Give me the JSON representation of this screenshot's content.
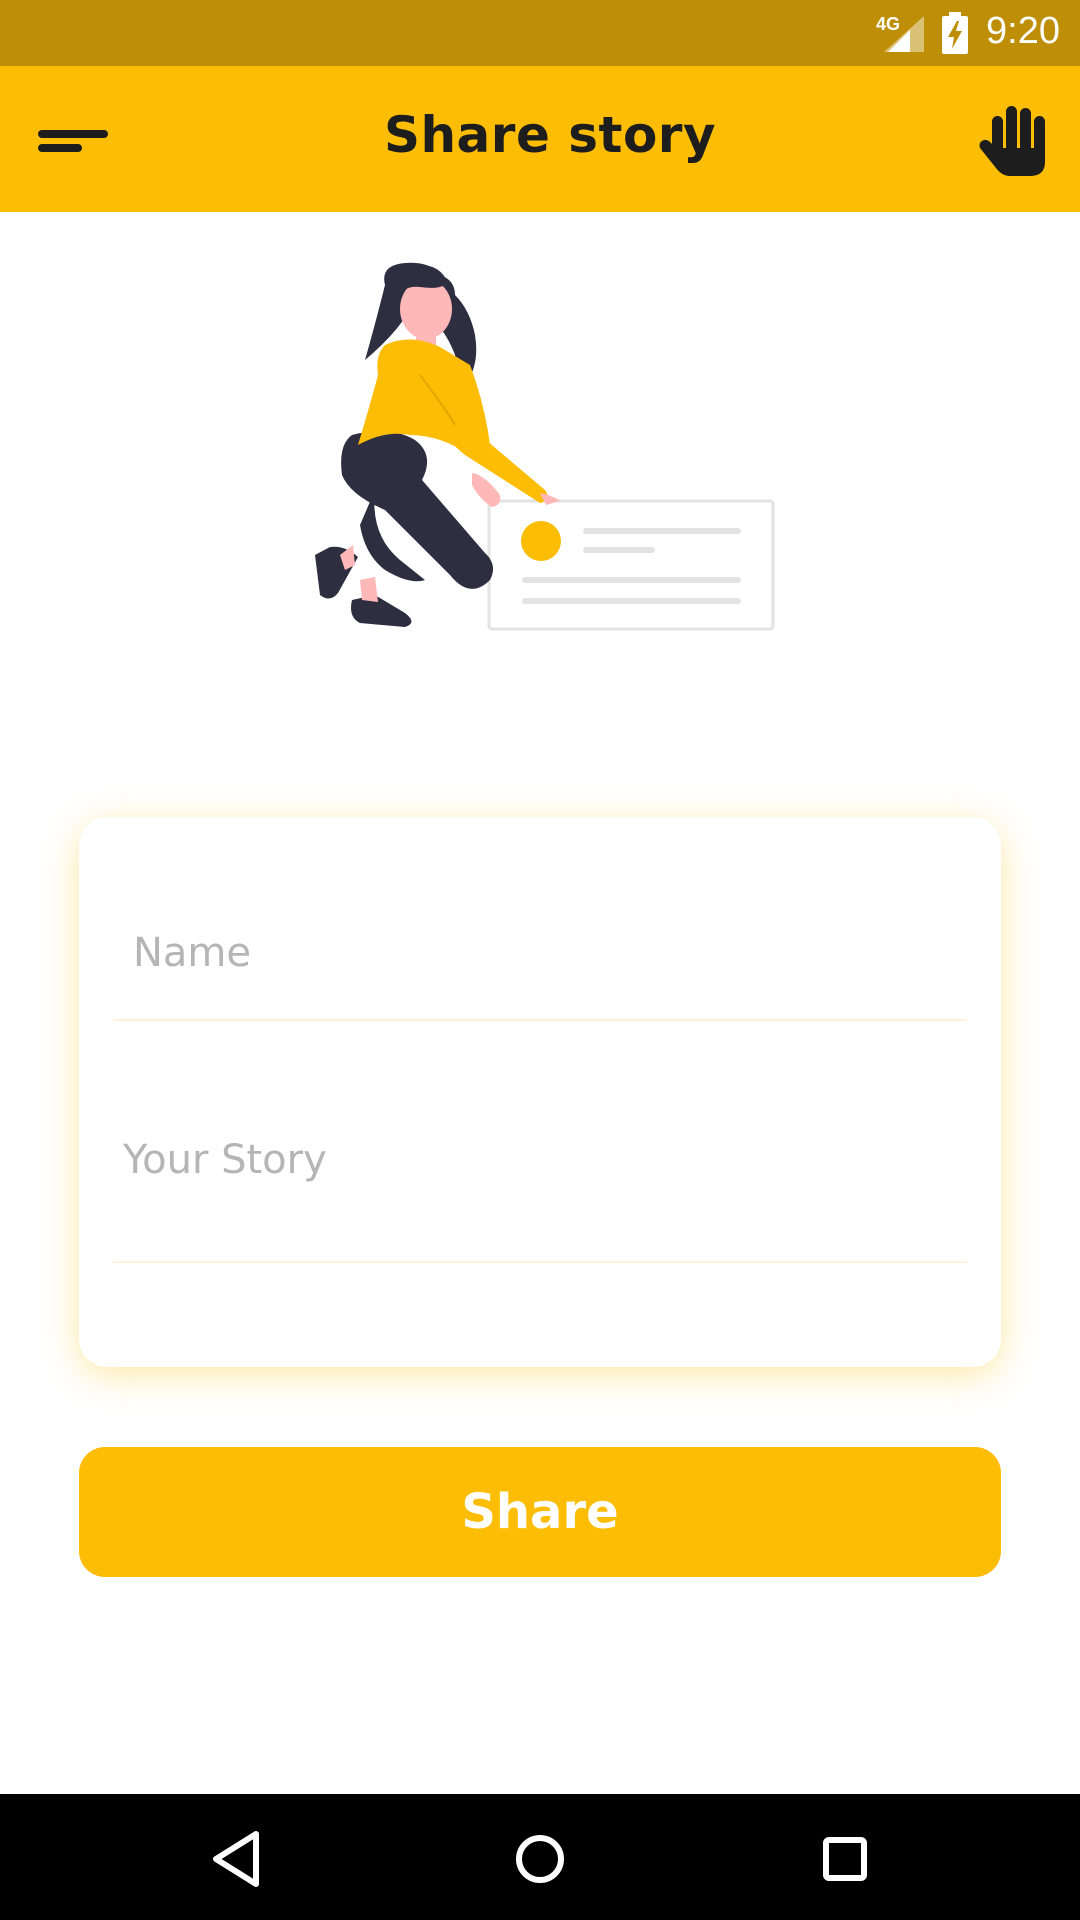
{
  "status_bar": {
    "network": "4G",
    "time": "9:20"
  },
  "app_bar": {
    "title": "Share story",
    "menu_icon": "menu-icon",
    "action_icon": "hand-icon"
  },
  "form": {
    "name_placeholder": "Name",
    "name_value": "",
    "story_placeholder": "Your Story",
    "story_value": ""
  },
  "share_button": {
    "label": "Share"
  },
  "nav_bar": {
    "back_icon": "back-icon",
    "home_icon": "home-icon",
    "recents_icon": "recents-icon"
  },
  "colors": {
    "accent": "#FCBD04",
    "status_bar": "#BE8E06",
    "text_dark": "#1d1d1d",
    "placeholder": "#b5b5b5"
  }
}
